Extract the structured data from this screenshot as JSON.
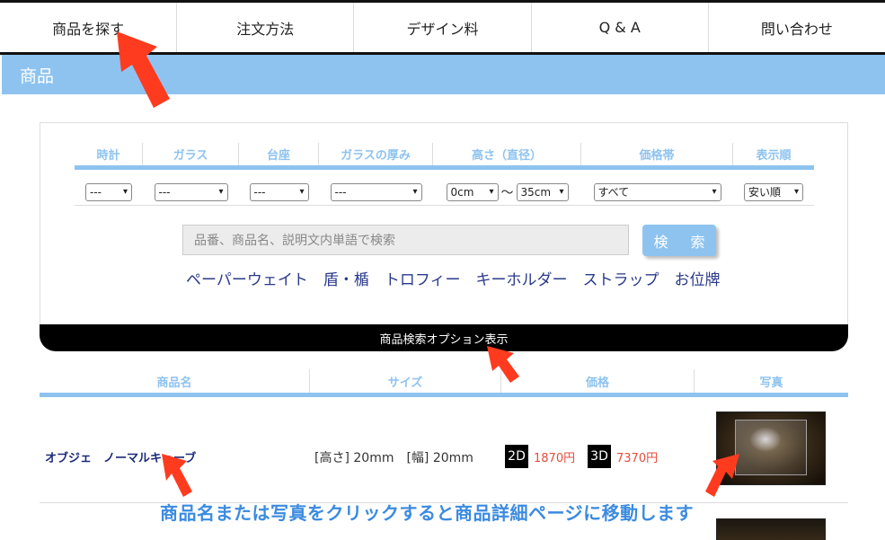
{
  "nav": {
    "items": [
      "商品を探す",
      "注文方法",
      "デザイン料",
      "Q & A",
      "問い合わせ"
    ]
  },
  "section": {
    "title": "商品"
  },
  "filters": {
    "headers": [
      "時計",
      "ガラス",
      "台座",
      "ガラスの厚み",
      "高さ（直径）",
      "価格帯",
      "表示順"
    ],
    "watch": "---",
    "glass": "---",
    "base": "---",
    "thickness": "---",
    "height_min": "0cm",
    "height_sep": "～",
    "height_max": "35cm",
    "price_band": "すべて",
    "sort": "安い順"
  },
  "search": {
    "placeholder": "品番、商品名、説明文内単語で検索",
    "button": "検 索"
  },
  "categories": [
    "ペーパーウェイト",
    "盾・楯",
    "トロフィー",
    "キーホルダー",
    "ストラップ",
    "お位牌"
  ],
  "option_bar": {
    "label": "商品検索オプション表示"
  },
  "results": {
    "headers": [
      "商品名",
      "サイズ",
      "価格",
      "写真"
    ],
    "rows": [
      {
        "name": "オブジェ　ノーマルキューブ",
        "size": "[高さ] 20mm　[幅] 20mm",
        "price_2d_tag": "2D",
        "price_2d": "1870円",
        "price_3d_tag": "3D",
        "price_3d": "7370円"
      }
    ]
  },
  "annotation": {
    "callout": "商品名または写真をクリックすると商品詳細ページに移動します",
    "arrow_color": "#ff3b1f"
  },
  "colors": {
    "accent": "#8ec3f0",
    "link": "#1a2a7a",
    "price": "#e74c3c",
    "callout": "#3b8be0"
  }
}
